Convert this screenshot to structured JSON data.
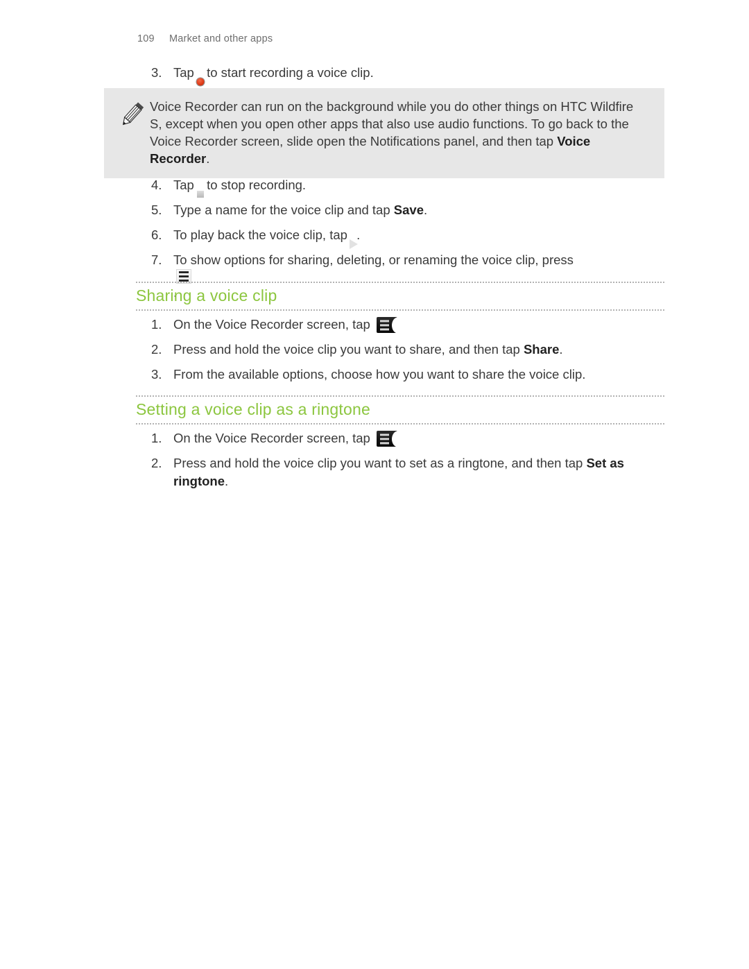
{
  "header": {
    "page_number": "109",
    "chapter_title": "Market and other apps"
  },
  "colors": {
    "heading_green": "#8cc63f",
    "note_background": "#e7e7e7",
    "body_text": "#3a3a3a",
    "header_text": "#6e6e6e",
    "record_red": "#e03c18"
  },
  "steps_top": [
    {
      "number": "3.",
      "before_icon": "Tap",
      "icon": "record-button-icon",
      "after_icon": "to start recording a voice clip."
    },
    {
      "number": "4.",
      "before_icon": "Tap",
      "icon": "stop-button-icon",
      "after_icon": "to stop recording."
    },
    {
      "number": "5.",
      "text_before_bold": "Type a name for the voice clip and tap ",
      "bold": "Save",
      "text_after_bold": "."
    },
    {
      "number": "6.",
      "before_icon": "To play back the voice clip, tap",
      "icon": "play-button-icon",
      "after_icon": "."
    },
    {
      "number": "7.",
      "before_icon": "To show options for sharing, deleting, or renaming the voice clip, press",
      "icon": "menu-key-icon",
      "after_icon": "."
    }
  ],
  "note": {
    "icon": "pencil-icon",
    "text_part1": "Voice Recorder can run on the background while you do other things on HTC Wildfire S, except when you open other apps that also use audio functions. To go back to the Voice Recorder screen, slide open the Notifications panel, and then tap ",
    "bold": "Voice Recorder",
    "text_part2": "."
  },
  "sections": [
    {
      "title": "Sharing a voice clip",
      "steps": [
        {
          "number": "1.",
          "before_icon": "On the Voice Recorder screen, tap",
          "icon": "list-button-icon",
          "after_icon": "."
        },
        {
          "number": "2.",
          "text_before_bold": "Press and hold the voice clip you want to share, and then tap ",
          "bold": "Share",
          "text_after_bold": "."
        },
        {
          "number": "3.",
          "text_before_bold": "From the available options, choose how you want to share the voice clip.",
          "bold": "",
          "text_after_bold": ""
        }
      ]
    },
    {
      "title": "Setting a voice clip as a ringtone",
      "steps": [
        {
          "number": "1.",
          "before_icon": "On the Voice Recorder screen, tap",
          "icon": "list-button-icon",
          "after_icon": "."
        },
        {
          "number": "2.",
          "text_before_bold": "Press and hold the voice clip you want to set as a ringtone, and then tap ",
          "bold": "Set as ringtone",
          "text_after_bold": "."
        }
      ]
    }
  ]
}
